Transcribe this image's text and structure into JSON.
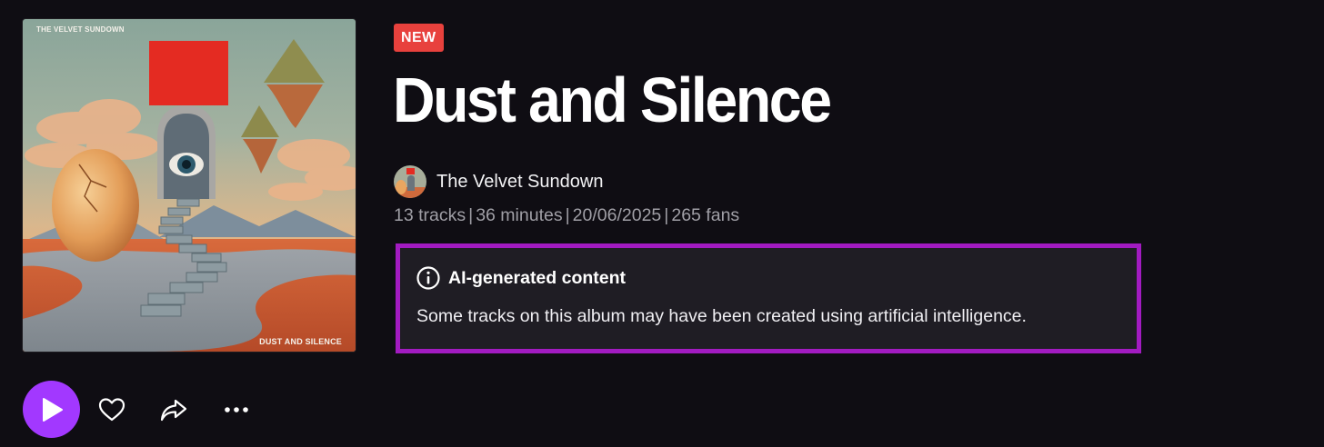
{
  "cover": {
    "artist_text": "THE VELVET SUNDOWN",
    "album_text": "DUST AND SILENCE"
  },
  "album": {
    "badge": "NEW",
    "title": "Dust and Silence",
    "artist": "The Velvet Sundown",
    "meta": {
      "tracks": "13 tracks",
      "duration": "36 minutes",
      "date": "20/06/2025",
      "fans": "265 fans"
    }
  },
  "notice": {
    "title": "AI-generated content",
    "text": "Some tracks on this album may have been created using artificial intelligence."
  },
  "colors": {
    "background": "#0f0d13",
    "badge": "#e8413d",
    "highlight_border": "#a21bc1",
    "play": "#a238ff",
    "notice_bg": "#1f1d24",
    "meta_text": "#a09fa6"
  },
  "icons": {
    "play": "play-icon",
    "favorite": "heart-icon",
    "share": "share-icon",
    "more": "more-icon",
    "info": "info-icon"
  }
}
